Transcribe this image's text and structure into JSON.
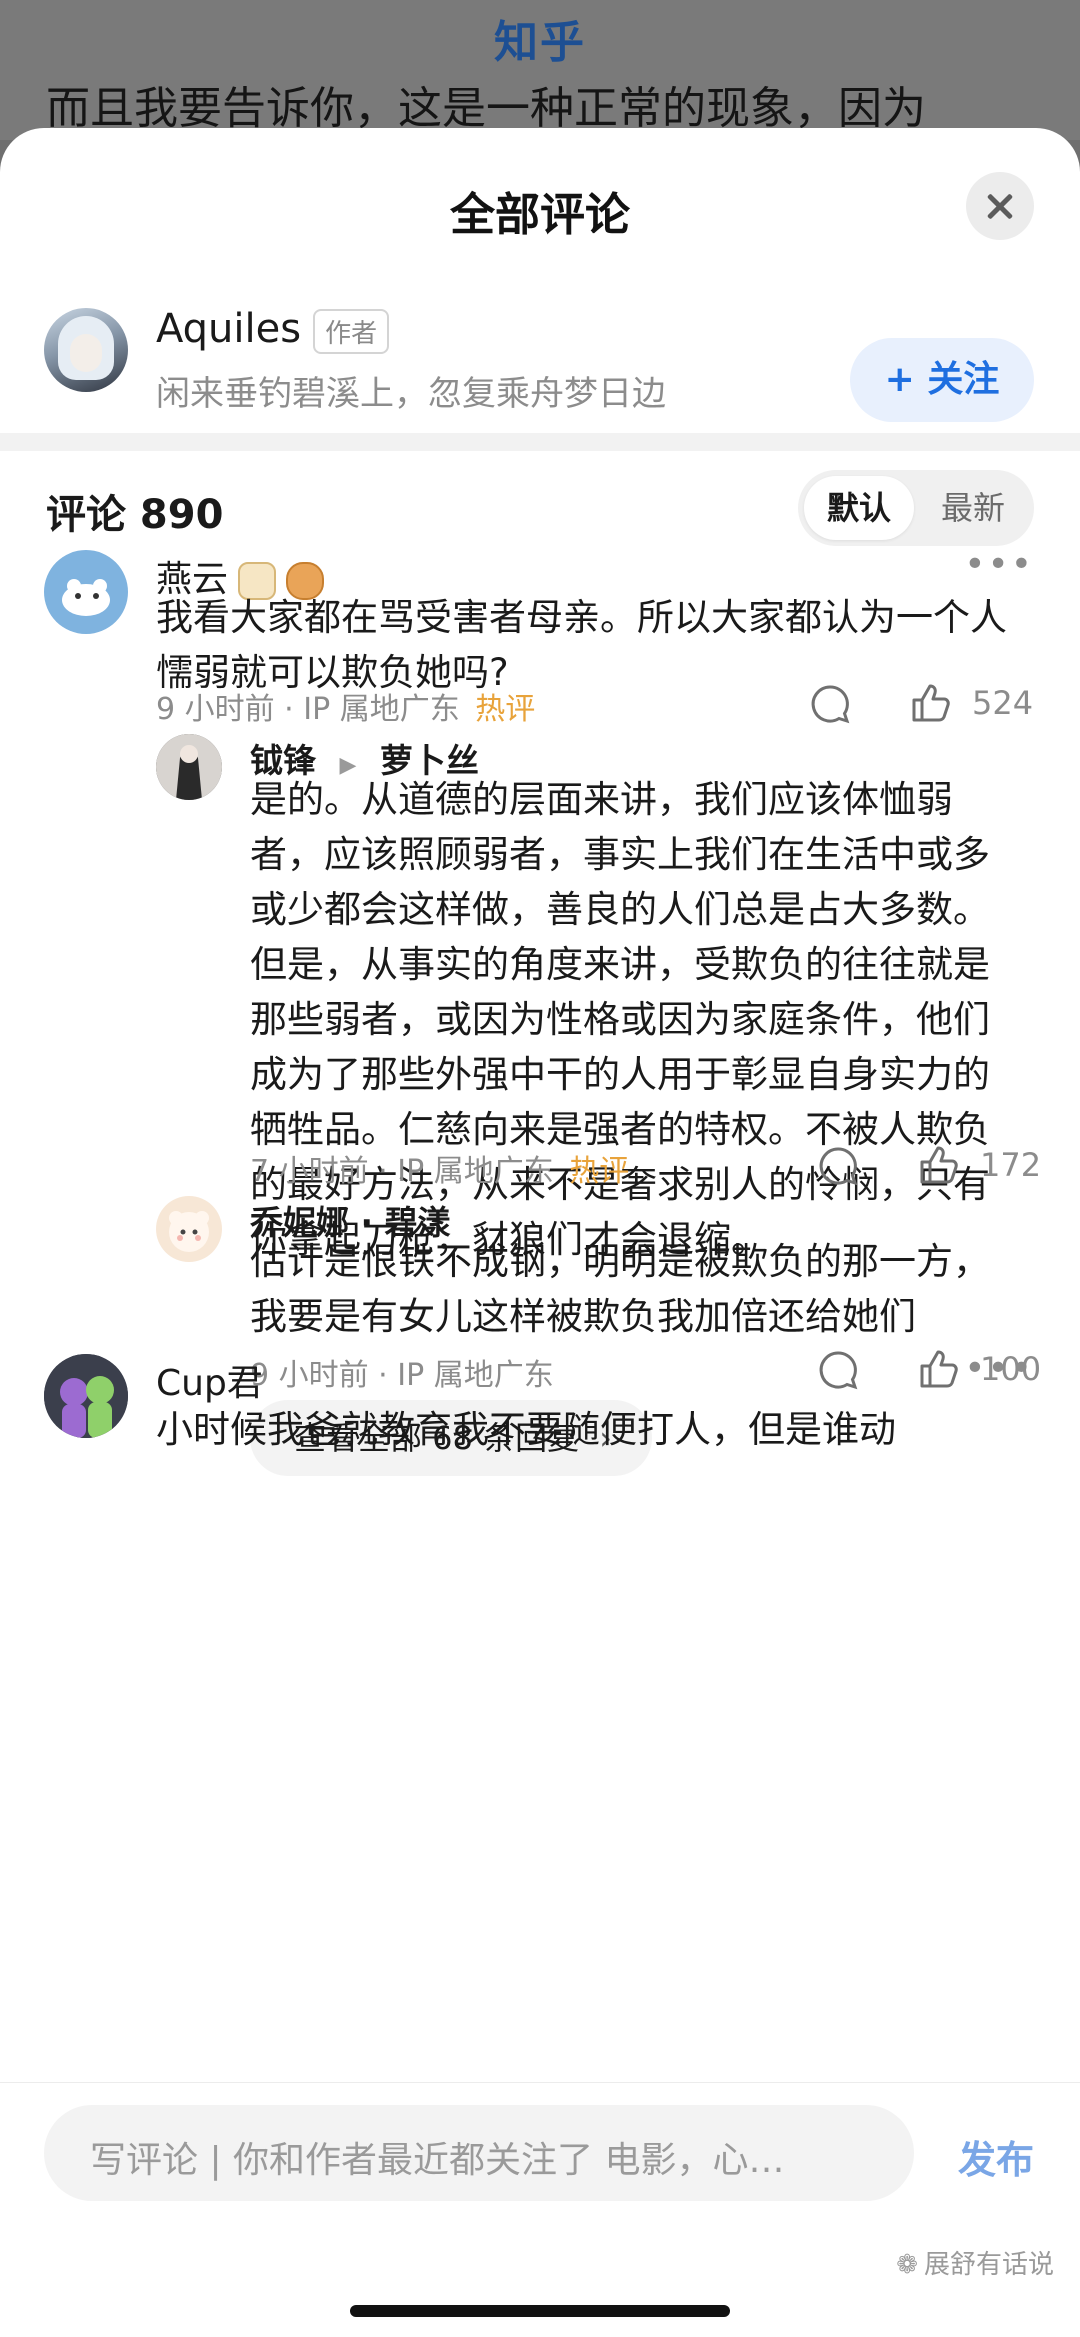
{
  "backdrop": {
    "site_name": "知乎",
    "article_line": "而且我要告诉你，这是一种正常的现象，因为"
  },
  "sheet": {
    "title": "全部评论",
    "close_icon": "close-icon"
  },
  "author": {
    "name": "Aquiles",
    "tag": "作者",
    "signature": "闲来垂钓碧溪上，忽复乘舟梦日边",
    "follow_label": "+ 关注"
  },
  "comments_header": {
    "count_label": "评论 890",
    "sort_default": "默认",
    "sort_latest": "最新"
  },
  "comments": [
    {
      "name": "燕云",
      "badges": [
        "crown-badge-icon",
        "eye-badge-icon"
      ],
      "text": "我看大家都在骂受害者母亲。所以大家都认为一个人懦弱就可以欺负她吗?",
      "time": "9 小时前",
      "ip": "· IP 属地广东",
      "hot": "热评",
      "likes": "524",
      "replies": [
        {
          "name": "钺锋",
          "reply_to": "萝卜丝",
          "text": "是的。从道德的层面来讲，我们应该体恤弱者，应该照顾弱者，事实上我们在生活中或多或少都会这样做，善良的人们总是占大多数。但是，从事实的角度来讲，受欺负的往往就是那些弱者，或因为性格或因为家庭条件，他们成为了那些外强中干的人用于彰显自身实力的牺牲品。仁慈向来是强者的特权。不被人欺负的最好方法，从来不是奢求别人的怜悯，只有你拿起刀枪，豺狼们才会退缩。",
          "time": "7 小时前",
          "ip": "· IP 属地广东",
          "hot": "热评",
          "likes": "172"
        },
        {
          "name": "乔妮娜 · 碧漾",
          "text": "估计是恨铁不成钢，明明是被欺负的那一方，我要是有女儿这样被欺负我加倍还给她们",
          "time": "9 小时前",
          "ip": "· IP 属地广东",
          "likes": "100"
        }
      ],
      "view_all_label": "查看全部 68 条回复"
    },
    {
      "name": "Cup君",
      "text_partial": "小时候我爸就教育我不要随便打人，但是谁动"
    }
  ],
  "bottom_bar": {
    "placeholder": "写评论 | 你和作者最近都关注了 电影，心…",
    "publish_label": "发布",
    "watermark": "展舒有话说"
  }
}
